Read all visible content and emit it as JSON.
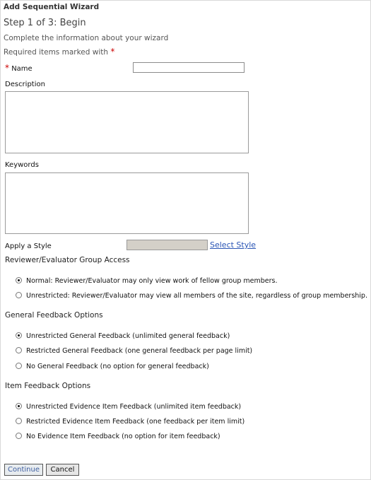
{
  "page": {
    "title": "Add Sequential Wizard",
    "step": "Step 1 of 3: Begin",
    "instructions": "Complete the information about your wizard",
    "required_note": "Required items marked with",
    "required_symbol": "*"
  },
  "form": {
    "name_label": "Name",
    "name_value": "",
    "description_label": "Description",
    "description_value": "",
    "keywords_label": "Keywords",
    "keywords_value": "",
    "style_label": "Apply a Style",
    "style_value": "",
    "select_style_link": "Select Style"
  },
  "group_access": {
    "heading": "Reviewer/Evaluator Group Access",
    "options": [
      {
        "label": "Normal: Reviewer/Evaluator may only view work of fellow group members.",
        "checked": true
      },
      {
        "label": "Unrestricted: Reviewer/Evaluator may view all members of the site, regardless of group membership.",
        "checked": false
      }
    ]
  },
  "general_feedback": {
    "heading": "General Feedback Options",
    "options": [
      {
        "label": "Unrestricted General Feedback (unlimited general feedback)",
        "checked": true
      },
      {
        "label": "Restricted General Feedback (one general feedback per page limit)",
        "checked": false
      },
      {
        "label": "No General Feedback (no option for general feedback)",
        "checked": false
      }
    ]
  },
  "item_feedback": {
    "heading": "Item Feedback Options",
    "options": [
      {
        "label": "Unrestricted Evidence Item Feedback (unlimited item feedback)",
        "checked": true
      },
      {
        "label": "Restricted Evidence Item Feedback (one feedback per item limit)",
        "checked": false
      },
      {
        "label": "No Evidence Item Feedback (no option for item feedback)",
        "checked": false
      }
    ]
  },
  "actions": {
    "continue_label": "Continue",
    "cancel_label": "Cancel"
  },
  "colors": {
    "required": "#cc0000",
    "link": "#2a55b5",
    "continue_text": "#3f5fa0"
  }
}
